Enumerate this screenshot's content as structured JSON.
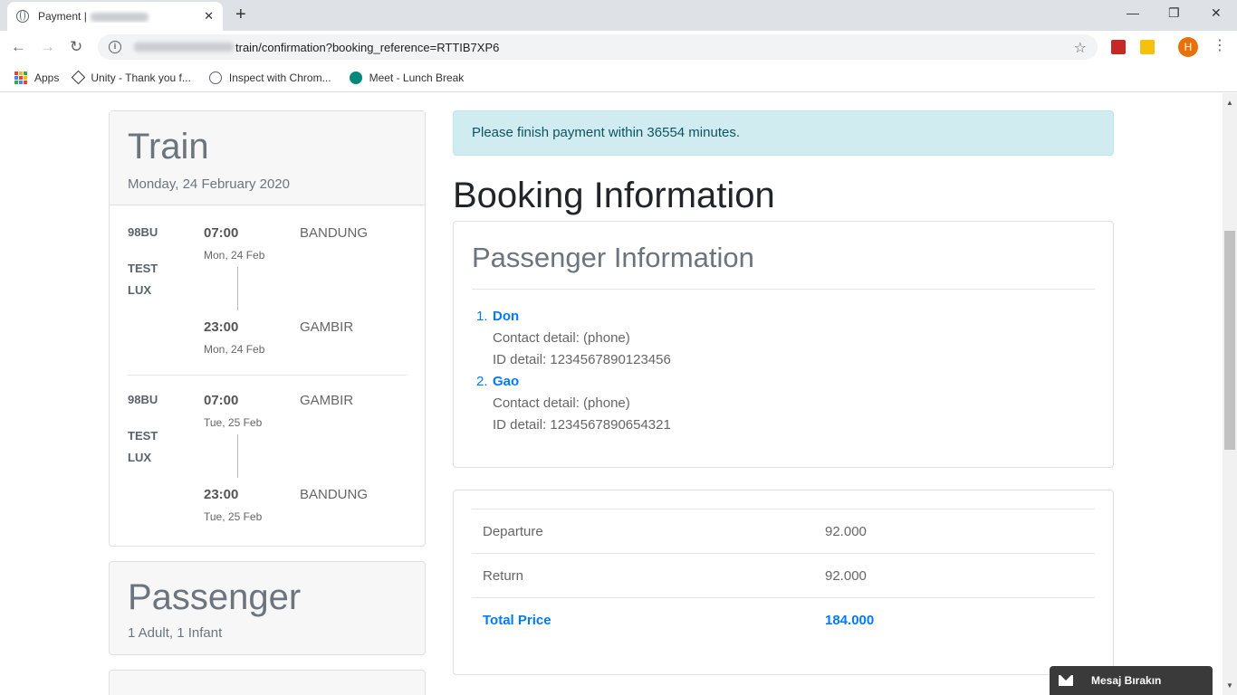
{
  "browser": {
    "tab_title": "Payment |",
    "tab_close": "✕",
    "new_tab": "+",
    "url_path": "train/confirmation?booking_reference=RTTIB7XP6",
    "profile_initial": "H",
    "bookmarks": [
      {
        "label": "Apps"
      },
      {
        "label": "Unity - Thank you f..."
      },
      {
        "label": "Inspect with Chrom..."
      },
      {
        "label": "Meet - Lunch Break"
      }
    ]
  },
  "trip": {
    "title": "Train",
    "date": "Monday, 24 February 2020",
    "legs": [
      {
        "code": "98BU",
        "class_line1": "TEST",
        "class_line2": "LUX",
        "depart_time": "07:00",
        "depart_date": "Mon, 24 Feb",
        "depart_station": "BANDUNG",
        "arrive_time": "23:00",
        "arrive_date": "Mon, 24 Feb",
        "arrive_station": "GAMBIR"
      },
      {
        "code": "98BU",
        "class_line1": "TEST",
        "class_line2": "LUX",
        "depart_time": "07:00",
        "depart_date": "Tue, 25 Feb",
        "depart_station": "GAMBIR",
        "arrive_time": "23:00",
        "arrive_date": "Tue, 25 Feb",
        "arrive_station": "BANDUNG"
      }
    ]
  },
  "passenger_summary": {
    "title": "Passenger",
    "count": "1 Adult, 1 Infant"
  },
  "alert": "Please finish payment within 36554 minutes.",
  "booking": {
    "heading": "Booking Information",
    "passenger_info_title": "Passenger Information",
    "passengers": [
      {
        "num": "1.",
        "name": "Don",
        "contact": "Contact detail: (phone)",
        "id": "ID detail: 1234567890123456"
      },
      {
        "num": "2.",
        "name": "Gao",
        "contact": "Contact detail: (phone)",
        "id": "ID detail: 1234567890654321"
      }
    ]
  },
  "price": {
    "rows": [
      {
        "label": "Departure",
        "value": "92.000"
      },
      {
        "label": "Return",
        "value": "92.000"
      }
    ],
    "total_label": "Total Price",
    "total_value": "184.000"
  },
  "chat": {
    "label": "Mesaj Bırakın"
  },
  "colors": {
    "accent": "#007bff",
    "alert_bg": "#d1ecf1",
    "alert_text": "#0c5460",
    "avatar": "#e8710a"
  }
}
